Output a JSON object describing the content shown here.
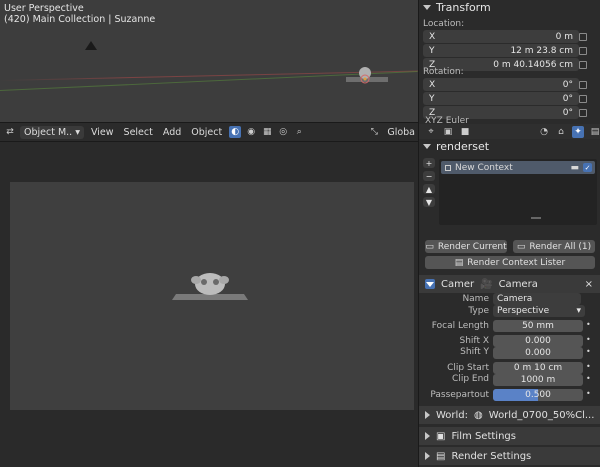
{
  "viewport": {
    "perspective_label": "User Perspective",
    "collection_label": "(420) Main Collection | Suzanne"
  },
  "header": {
    "mode_label": "Object M..",
    "menus": [
      "View",
      "Select",
      "Add",
      "Object"
    ],
    "orientation_label": "Globa"
  },
  "transform": {
    "title": "Transform",
    "location_label": "Location:",
    "location": [
      {
        "axis": "X",
        "value": "0 m"
      },
      {
        "axis": "Y",
        "value": "12 m 23.8 cm"
      },
      {
        "axis": "Z",
        "value": "0 m 40.14056 cm"
      }
    ],
    "rotation_label": "Rotation:",
    "rotation": [
      {
        "axis": "X",
        "value": "0°"
      },
      {
        "axis": "Y",
        "value": "0°"
      },
      {
        "axis": "Z",
        "value": "0°"
      }
    ],
    "rotation_mode": "XYZ Euler"
  },
  "renderset": {
    "title": "renderset",
    "list_item": "New Context",
    "render_current": "Render Current",
    "render_all": "Render All (1)",
    "lister": "Render Context Lister"
  },
  "camera": {
    "header_label": "Camer",
    "header_object": "Camera",
    "name_label": "Name",
    "name_value": "Camera",
    "type_label": "Type",
    "type_value": "Perspective",
    "focal_label": "Focal Length",
    "focal_value": "50 mm",
    "shift_x_label": "Shift X",
    "shift_x_value": "0.000",
    "shift_y_label": "Shift Y",
    "shift_y_value": "0.000",
    "clip_start_label": "Clip Start",
    "clip_start_value": "0 m 10 cm",
    "clip_end_label": "Clip End",
    "clip_end_value": "1000 m",
    "passepartout_label": "Passepartout",
    "passepartout_value": "0.500",
    "passepartout_fraction": 0.5
  },
  "sections": {
    "world_label": "World:",
    "world_value": "World_0700_50%Cl...",
    "film_settings": "Film Settings",
    "render_settings": "Render Settings"
  }
}
